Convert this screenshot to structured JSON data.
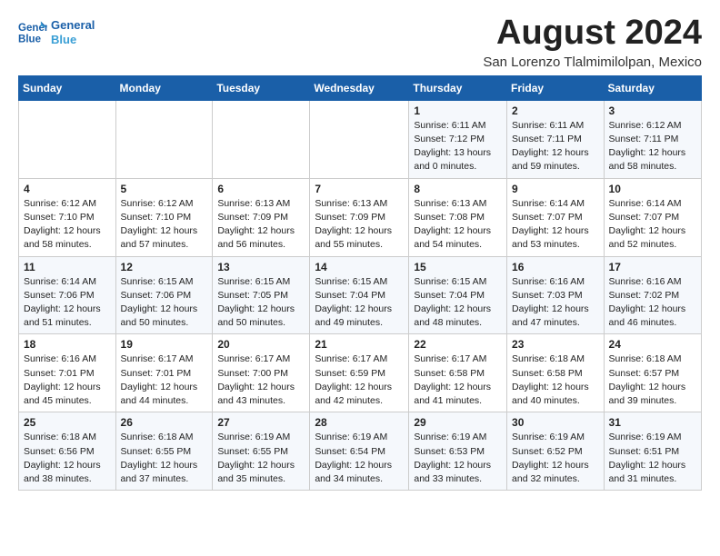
{
  "logo": {
    "name": "General Blue",
    "line1": "General",
    "line2": "Blue"
  },
  "title": "August 2024",
  "location": "San Lorenzo Tlalmimilolpan, Mexico",
  "days_of_week": [
    "Sunday",
    "Monday",
    "Tuesday",
    "Wednesday",
    "Thursday",
    "Friday",
    "Saturday"
  ],
  "weeks": [
    [
      {
        "num": "",
        "detail": ""
      },
      {
        "num": "",
        "detail": ""
      },
      {
        "num": "",
        "detail": ""
      },
      {
        "num": "",
        "detail": ""
      },
      {
        "num": "1",
        "detail": "Sunrise: 6:11 AM\nSunset: 7:12 PM\nDaylight: 13 hours\nand 0 minutes."
      },
      {
        "num": "2",
        "detail": "Sunrise: 6:11 AM\nSunset: 7:11 PM\nDaylight: 12 hours\nand 59 minutes."
      },
      {
        "num": "3",
        "detail": "Sunrise: 6:12 AM\nSunset: 7:11 PM\nDaylight: 12 hours\nand 58 minutes."
      }
    ],
    [
      {
        "num": "4",
        "detail": "Sunrise: 6:12 AM\nSunset: 7:10 PM\nDaylight: 12 hours\nand 58 minutes."
      },
      {
        "num": "5",
        "detail": "Sunrise: 6:12 AM\nSunset: 7:10 PM\nDaylight: 12 hours\nand 57 minutes."
      },
      {
        "num": "6",
        "detail": "Sunrise: 6:13 AM\nSunset: 7:09 PM\nDaylight: 12 hours\nand 56 minutes."
      },
      {
        "num": "7",
        "detail": "Sunrise: 6:13 AM\nSunset: 7:09 PM\nDaylight: 12 hours\nand 55 minutes."
      },
      {
        "num": "8",
        "detail": "Sunrise: 6:13 AM\nSunset: 7:08 PM\nDaylight: 12 hours\nand 54 minutes."
      },
      {
        "num": "9",
        "detail": "Sunrise: 6:14 AM\nSunset: 7:07 PM\nDaylight: 12 hours\nand 53 minutes."
      },
      {
        "num": "10",
        "detail": "Sunrise: 6:14 AM\nSunset: 7:07 PM\nDaylight: 12 hours\nand 52 minutes."
      }
    ],
    [
      {
        "num": "11",
        "detail": "Sunrise: 6:14 AM\nSunset: 7:06 PM\nDaylight: 12 hours\nand 51 minutes."
      },
      {
        "num": "12",
        "detail": "Sunrise: 6:15 AM\nSunset: 7:06 PM\nDaylight: 12 hours\nand 50 minutes."
      },
      {
        "num": "13",
        "detail": "Sunrise: 6:15 AM\nSunset: 7:05 PM\nDaylight: 12 hours\nand 50 minutes."
      },
      {
        "num": "14",
        "detail": "Sunrise: 6:15 AM\nSunset: 7:04 PM\nDaylight: 12 hours\nand 49 minutes."
      },
      {
        "num": "15",
        "detail": "Sunrise: 6:15 AM\nSunset: 7:04 PM\nDaylight: 12 hours\nand 48 minutes."
      },
      {
        "num": "16",
        "detail": "Sunrise: 6:16 AM\nSunset: 7:03 PM\nDaylight: 12 hours\nand 47 minutes."
      },
      {
        "num": "17",
        "detail": "Sunrise: 6:16 AM\nSunset: 7:02 PM\nDaylight: 12 hours\nand 46 minutes."
      }
    ],
    [
      {
        "num": "18",
        "detail": "Sunrise: 6:16 AM\nSunset: 7:01 PM\nDaylight: 12 hours\nand 45 minutes."
      },
      {
        "num": "19",
        "detail": "Sunrise: 6:17 AM\nSunset: 7:01 PM\nDaylight: 12 hours\nand 44 minutes."
      },
      {
        "num": "20",
        "detail": "Sunrise: 6:17 AM\nSunset: 7:00 PM\nDaylight: 12 hours\nand 43 minutes."
      },
      {
        "num": "21",
        "detail": "Sunrise: 6:17 AM\nSunset: 6:59 PM\nDaylight: 12 hours\nand 42 minutes."
      },
      {
        "num": "22",
        "detail": "Sunrise: 6:17 AM\nSunset: 6:58 PM\nDaylight: 12 hours\nand 41 minutes."
      },
      {
        "num": "23",
        "detail": "Sunrise: 6:18 AM\nSunset: 6:58 PM\nDaylight: 12 hours\nand 40 minutes."
      },
      {
        "num": "24",
        "detail": "Sunrise: 6:18 AM\nSunset: 6:57 PM\nDaylight: 12 hours\nand 39 minutes."
      }
    ],
    [
      {
        "num": "25",
        "detail": "Sunrise: 6:18 AM\nSunset: 6:56 PM\nDaylight: 12 hours\nand 38 minutes."
      },
      {
        "num": "26",
        "detail": "Sunrise: 6:18 AM\nSunset: 6:55 PM\nDaylight: 12 hours\nand 37 minutes."
      },
      {
        "num": "27",
        "detail": "Sunrise: 6:19 AM\nSunset: 6:55 PM\nDaylight: 12 hours\nand 35 minutes."
      },
      {
        "num": "28",
        "detail": "Sunrise: 6:19 AM\nSunset: 6:54 PM\nDaylight: 12 hours\nand 34 minutes."
      },
      {
        "num": "29",
        "detail": "Sunrise: 6:19 AM\nSunset: 6:53 PM\nDaylight: 12 hours\nand 33 minutes."
      },
      {
        "num": "30",
        "detail": "Sunrise: 6:19 AM\nSunset: 6:52 PM\nDaylight: 12 hours\nand 32 minutes."
      },
      {
        "num": "31",
        "detail": "Sunrise: 6:19 AM\nSunset: 6:51 PM\nDaylight: 12 hours\nand 31 minutes."
      }
    ]
  ]
}
